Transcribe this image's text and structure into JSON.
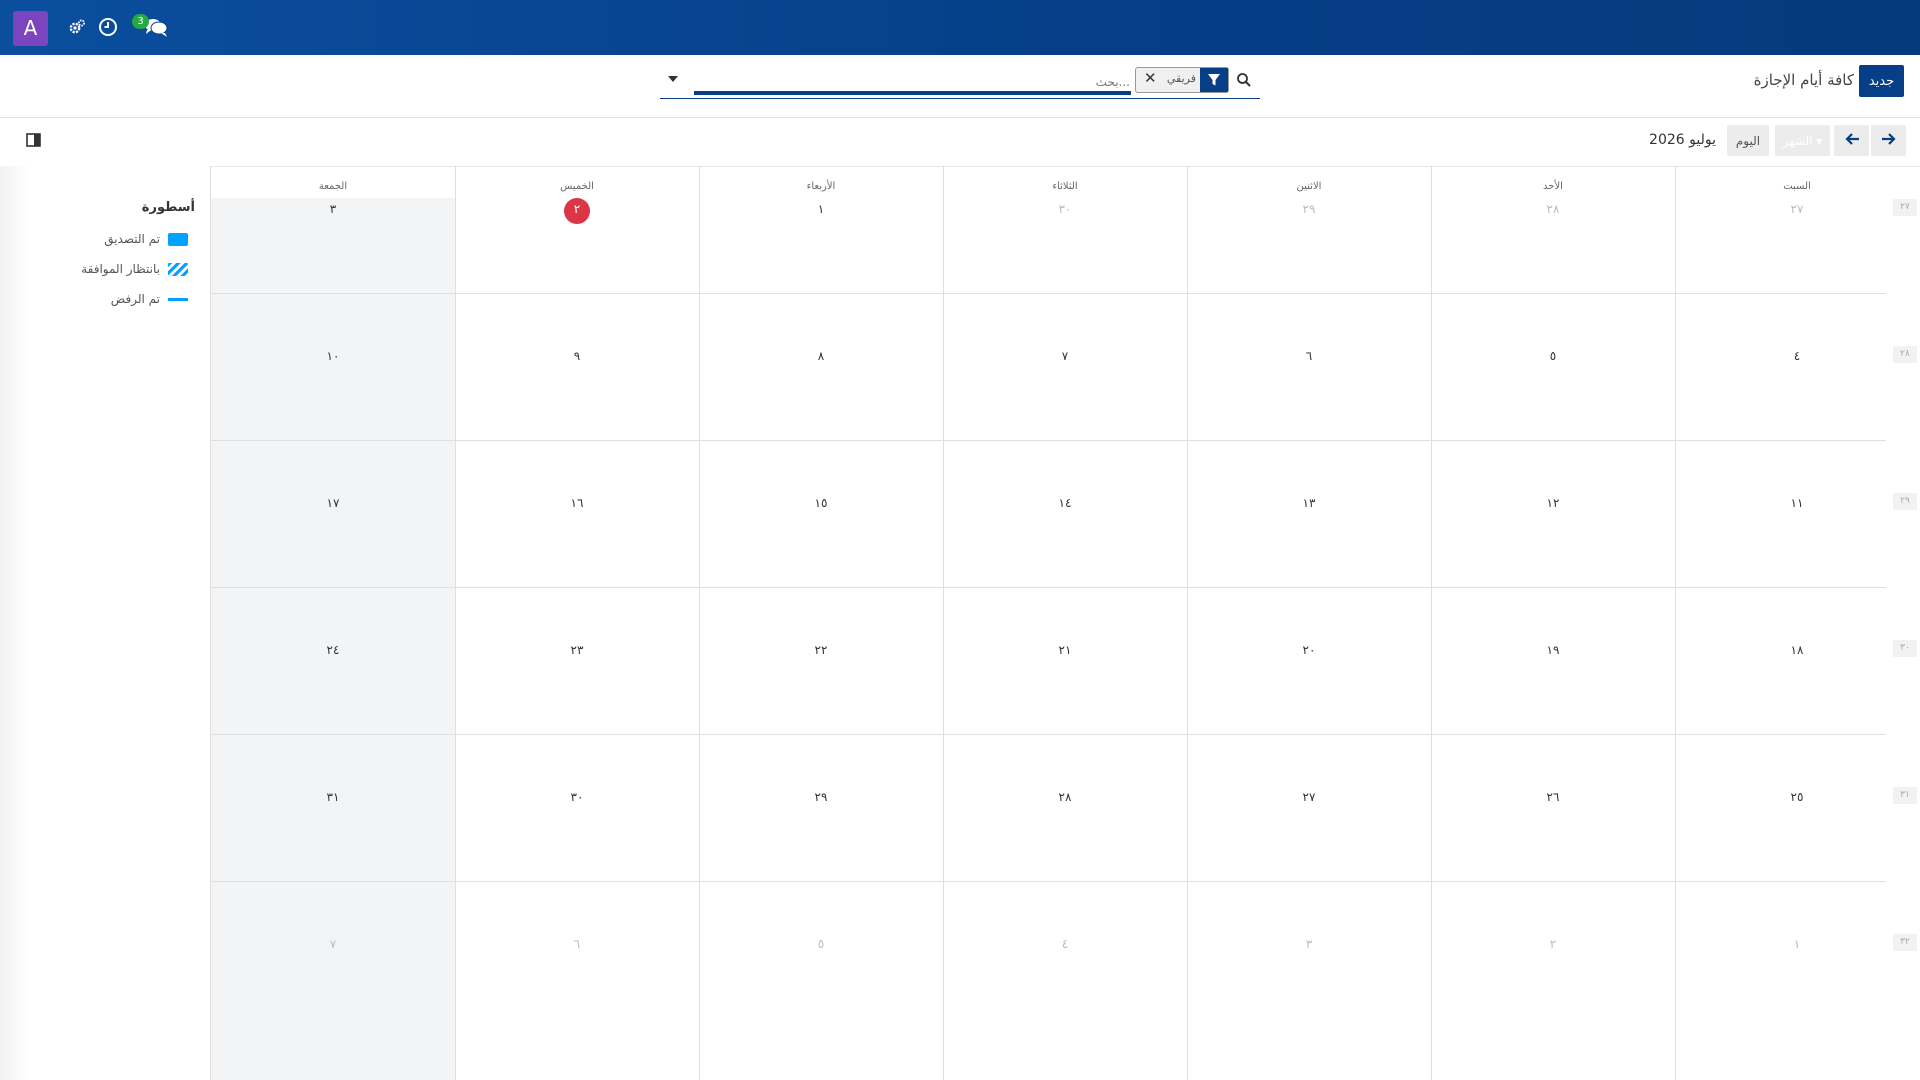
{
  "navbar": {
    "avatar_letter": "A",
    "notification_count": "3",
    "icons": [
      "gear-icon",
      "clock-icon",
      "chat-icon"
    ],
    "background": "#063f88",
    "avatar_color": "#7b45bf"
  },
  "control_panel": {
    "new_button_label": "جديد",
    "title": "كافة أيام الإجازة",
    "facet_label": "فريقي",
    "search_placeholder": "بحث..."
  },
  "toolbar": {
    "scale_label": "الشهر",
    "today_label": "اليوم",
    "period": "يوليو 2026"
  },
  "legend": {
    "title": "أسطورة",
    "items": [
      {
        "label": "تم التصديق",
        "style": "solid",
        "color": "#00a3ff"
      },
      {
        "label": "بانتظار الموافقة",
        "style": "striped",
        "color": "#00a3ff"
      },
      {
        "label": "تم الرفض",
        "style": "line",
        "color": "#00a3ff"
      }
    ]
  },
  "calendar": {
    "day_headers": [
      "السبت",
      "الأحد",
      "الاثنين",
      "الثلاثاء",
      "الأربعاء",
      "الخميس",
      "الجمعة"
    ],
    "week_numbers": [
      "٢٧",
      "٢٨",
      "٢٩",
      "٣٠",
      "٣١",
      "٣٢"
    ],
    "weeks": [
      [
        "٢٧",
        "٢٨",
        "٢٩",
        "٣٠",
        "١",
        "٢",
        "٣"
      ],
      [
        "٤",
        "٥",
        "٦",
        "٧",
        "٨",
        "٩",
        "١٠"
      ],
      [
        "١١",
        "١٢",
        "١٣",
        "١٤",
        "١٥",
        "١٦",
        "١٧"
      ],
      [
        "١٨",
        "١٩",
        "٢٠",
        "٢١",
        "٢٢",
        "٢٣",
        "٢٤"
      ],
      [
        "٢٥",
        "٢٦",
        "٢٧",
        "٢٨",
        "٢٩",
        "٣٠",
        "٣١"
      ],
      [
        "١",
        "٢",
        "٣",
        "٤",
        "٥",
        "٦",
        "٧"
      ]
    ],
    "muted_days": {
      "0": [
        0,
        1,
        2,
        3
      ],
      "5": [
        0,
        1,
        2,
        3,
        4,
        5,
        6
      ]
    },
    "today": {
      "week": 0,
      "day": 5
    },
    "today_color": "#dc3545"
  }
}
